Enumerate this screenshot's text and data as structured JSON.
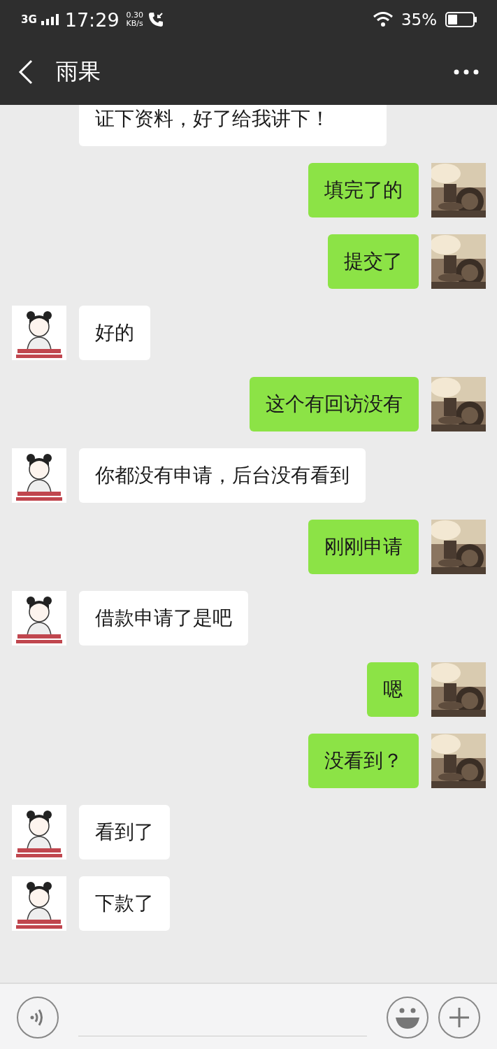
{
  "status_bar": {
    "network": "3G",
    "time": "17:29",
    "speed_value": "0.30",
    "speed_unit": "KB/s",
    "battery": "35%"
  },
  "header": {
    "title": "雨果"
  },
  "messages": [
    {
      "kind": "received",
      "avatar": false,
      "text": "证下资料，好了给我讲下！"
    },
    {
      "kind": "sent",
      "avatar": true,
      "text": "填完了的"
    },
    {
      "kind": "sent",
      "avatar": true,
      "text": "提交了"
    },
    {
      "kind": "received",
      "avatar": true,
      "text": "好的"
    },
    {
      "kind": "sent",
      "avatar": true,
      "text": "这个有回访没有"
    },
    {
      "kind": "received",
      "avatar": true,
      "text": "你都没有申请，后台没有看到"
    },
    {
      "kind": "sent",
      "avatar": true,
      "text": "刚刚申请"
    },
    {
      "kind": "received",
      "avatar": true,
      "text": "借款申请了是吧"
    },
    {
      "kind": "sent",
      "avatar": true,
      "text": "嗯"
    },
    {
      "kind": "sent",
      "avatar": true,
      "text": "没看到？"
    },
    {
      "kind": "received",
      "avatar": true,
      "text": "看到了"
    },
    {
      "kind": "received",
      "avatar": true,
      "text": "下款了"
    }
  ]
}
